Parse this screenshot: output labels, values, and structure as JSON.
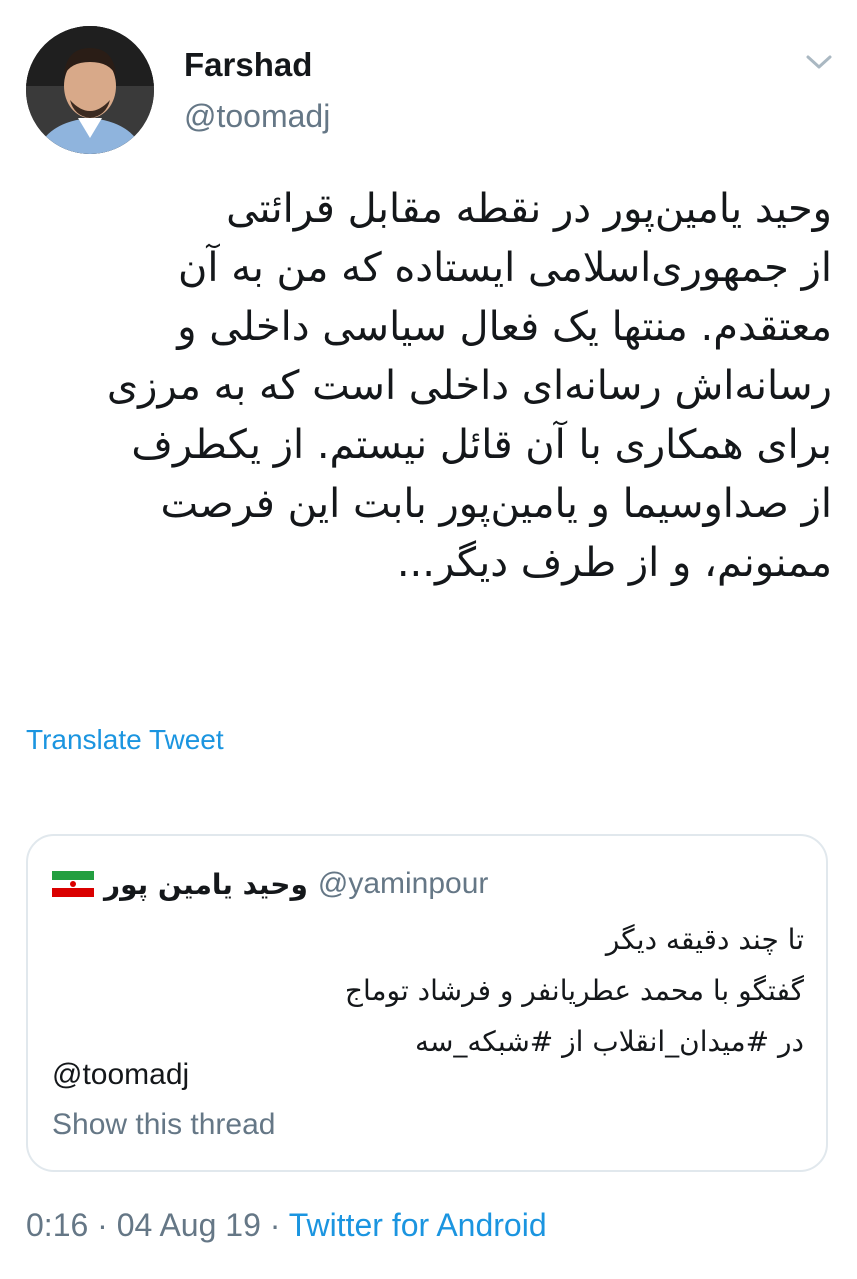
{
  "author": {
    "name": "Farshad",
    "handle": "@toomadj",
    "avatar_icon": "profile-photo"
  },
  "tweet": {
    "lines": [
      "وحید یامین‌پور در نقطه مقابل قرائتی",
      "از جمهوری‌اسلامی ایستاده که من به آن",
      "معتقدم. منتها یک فعال سیاسی داخلی و",
      "رسانه‌اش رسانه‌ای داخلی است که به مرزی",
      "برای همکاری با آن قائل نیستم. از یکطرف",
      "از صداوسیما و یامین‌پور بابت این فرصت",
      "ممنونم، و از طرف دیگر..."
    ],
    "translate_label": "Translate Tweet"
  },
  "quoted": {
    "name": "وحید یامین پور",
    "flag": "iran-flag",
    "handle": "@yaminpour",
    "lines": [
      "تا چند دقیقه دیگر",
      "گفتگو با محمد عطریانفر و فرشاد توماج",
      "در #میدان_انقلاب از #شبکه_سه"
    ],
    "mention": "@toomadj",
    "show_thread": "Show this thread"
  },
  "meta": {
    "time": "0:16",
    "sep1": " · ",
    "date": "04 Aug 19",
    "sep2": " · ",
    "source": "Twitter for Android"
  },
  "colors": {
    "link": "#1b95e0",
    "secondary": "#657786",
    "text": "#14171a",
    "border": "#e1e8ed"
  }
}
